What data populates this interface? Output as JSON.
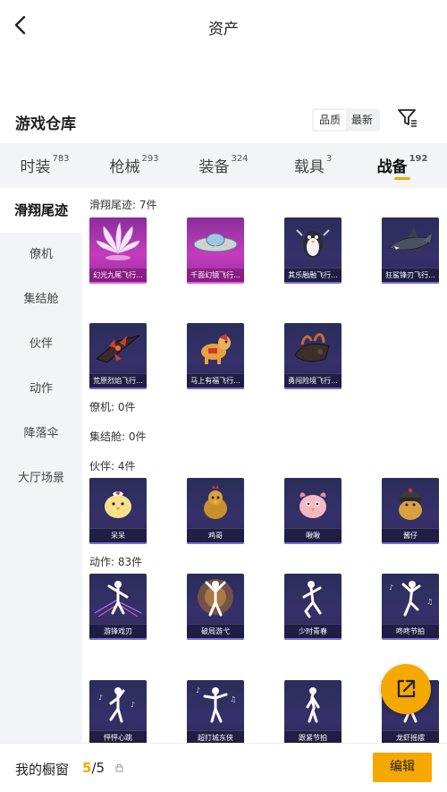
{
  "header": {
    "title": "资产",
    "back_icon": "chevron-left-icon"
  },
  "warehouse": {
    "title": "游戏仓库",
    "sort_options": [
      "品质",
      "最新"
    ],
    "filter_icon": "filter-icon"
  },
  "tabs": [
    {
      "label": "时装",
      "count": "783"
    },
    {
      "label": "枪械",
      "count": "293"
    },
    {
      "label": "装备",
      "count": "324"
    },
    {
      "label": "载具",
      "count": "3"
    },
    {
      "label": "战备",
      "count": "192"
    }
  ],
  "sidebar": [
    "滑翔尾迹",
    "僚机",
    "集结舱",
    "伙伴",
    "动作",
    "降落伞",
    "大厅场景"
  ],
  "sections": {
    "trail": {
      "label": "滑翔尾迹: 7件",
      "items": [
        "幻光九尾飞行...",
        "千面幻镜飞行...",
        "其乐融融飞行...",
        "狂鲨锋刃飞行...",
        "荒原烈焰飞行...",
        "马上有福飞行...",
        "勇闯险境飞行..."
      ]
    },
    "wingman": {
      "label": "僚机: 0件"
    },
    "pod": {
      "label": "集结舱: 0件"
    },
    "partner": {
      "label": "伙伴: 4件",
      "items": [
        "呆呆",
        "鸡哥",
        "啾啾",
        "酱仔"
      ]
    },
    "action": {
      "label": "动作: 83件",
      "items": [
        "游锋戏刃",
        "破局游弋",
        "少时青春",
        "咚咚节拍",
        "怦怦心跳",
        "超打城东侠",
        "跟紧节拍",
        "龙虾摇摆"
      ]
    }
  },
  "bottom": {
    "label": "我的橱窗",
    "current": "5",
    "total": "/5",
    "edit_label": "编辑"
  },
  "colors": {
    "accent": "#f5a800"
  }
}
